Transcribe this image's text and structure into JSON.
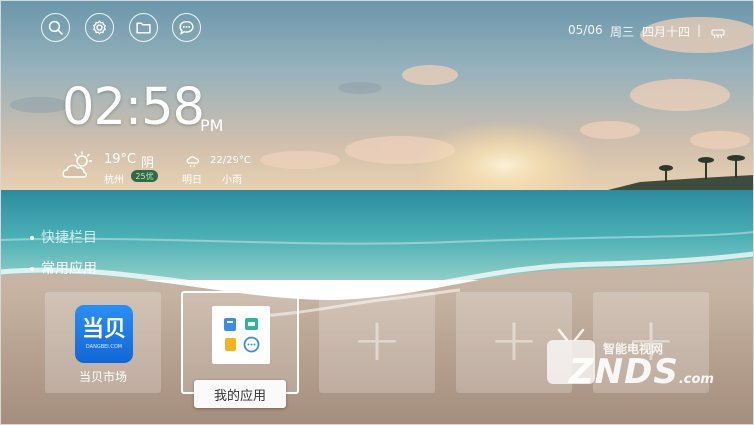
{
  "topbar": {
    "buttons": [
      {
        "icon": "search-icon"
      },
      {
        "icon": "gear-icon"
      },
      {
        "icon": "folder-icon"
      },
      {
        "icon": "chat-icon"
      }
    ],
    "date": "05/06",
    "weekday": "周三",
    "lunar": "四月十四",
    "separator": "|"
  },
  "clock": {
    "time": "02:58",
    "ampm": "PM"
  },
  "weather": {
    "today_temp": "19°C",
    "today_cond": "阴",
    "city": "杭州",
    "aqi": "25优",
    "tomorrow_range": "22/29°C",
    "tomorrow_label": "明日",
    "tomorrow_cond": "小雨"
  },
  "sections": {
    "quick": "快捷栏目",
    "common": "常用应用"
  },
  "apps": [
    {
      "label": "当贝市场",
      "logo_text": "当贝",
      "logo_sub": "DANGBEI.COM"
    },
    {
      "label": "我的应用"
    }
  ],
  "tooltip": "我的应用",
  "watermark": {
    "top": "智能电视网",
    "main": "ZNDS",
    "suffix": ".com"
  },
  "colors": {
    "dangbei_blue": "#1a7ce8",
    "aqi_green": "#2f6b45"
  }
}
